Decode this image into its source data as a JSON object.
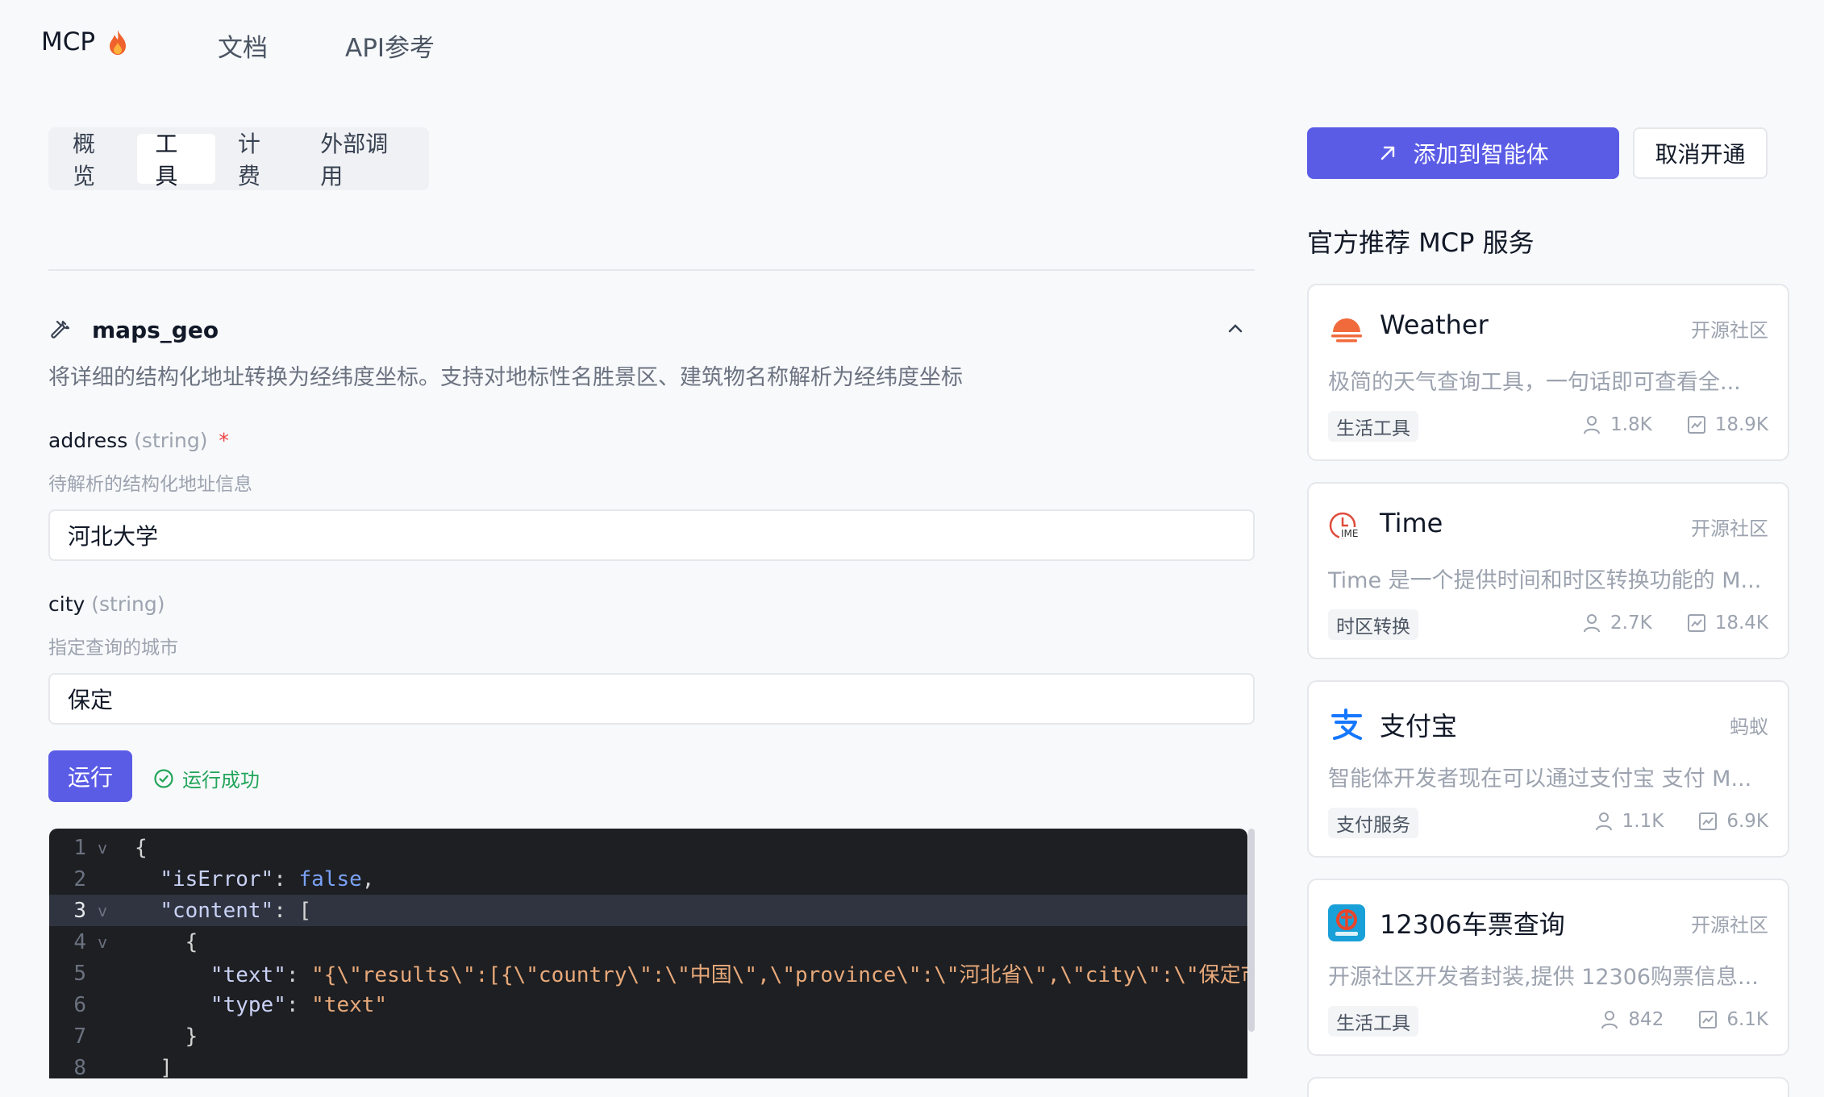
{
  "nav": {
    "brand": "MCP",
    "brand_icon": "flame-icon",
    "links": [
      "文档",
      "API参考"
    ]
  },
  "tabs": [
    {
      "label": "概览",
      "active": false
    },
    {
      "label": "工具",
      "active": true
    },
    {
      "label": "计费",
      "active": false
    },
    {
      "label": "外部调用",
      "active": false
    }
  ],
  "tool": {
    "name": "maps_geo",
    "description": "将详细的结构化地址转换为经纬度坐标。支持对地标性名胜景区、建筑物名称解析为经纬度坐标",
    "fields": [
      {
        "name": "address",
        "type": "(string)",
        "required": "*",
        "help": "待解析的结构化地址信息",
        "value": "河北大学"
      },
      {
        "name": "city",
        "type": "(string)",
        "required": "",
        "help": "指定查询的城市",
        "value": "保定"
      }
    ],
    "run_label": "运行",
    "run_status": "运行成功"
  },
  "code": {
    "lines": [
      {
        "n": "1",
        "fold": "v",
        "text": "{"
      },
      {
        "n": "2",
        "fold": "",
        "text": "  \"isError\": false,"
      },
      {
        "n": "3",
        "fold": "v",
        "text": "  \"content\": ["
      },
      {
        "n": "4",
        "fold": "v",
        "text": "    {"
      },
      {
        "n": "5",
        "fold": "",
        "text": "      \"text\": \"{\\\"results\\\":[{\\\"country\\\":\\\"中国\\\",\\\"province\\\":\\\"河北省\\\",\\\"city\\\":\\\"保定市"
      },
      {
        "n": "6",
        "fold": "",
        "text": "      \"type\": \"text\""
      },
      {
        "n": "7",
        "fold": "",
        "text": "    }"
      },
      {
        "n": "8",
        "fold": "",
        "text": "  ]"
      }
    ],
    "current_line": 3
  },
  "actions": {
    "add_label": "添加到智能体",
    "cancel_label": "取消开通"
  },
  "recommend": {
    "title": "官方推荐 MCP 服务",
    "cards": [
      {
        "name": "Weather",
        "source": "开源社区",
        "desc": "极简的天气查询工具，一句话即可查看全...",
        "tag": "生活工具",
        "users": "1.8K",
        "calls": "18.9K",
        "icon": "weather-sun-icon"
      },
      {
        "name": "Time",
        "source": "开源社区",
        "desc": "Time 是一个提供时间和时区转换功能的 M...",
        "tag": "时区转换",
        "users": "2.7K",
        "calls": "18.4K",
        "icon": "clock-icon"
      },
      {
        "name": "支付宝",
        "source": "蚂蚁",
        "desc": "智能体开发者现在可以通过支付宝 支付 M...",
        "tag": "支付服务",
        "users": "1.1K",
        "calls": "6.9K",
        "icon": "alipay-icon"
      },
      {
        "name": "12306车票查询",
        "source": "开源社区",
        "desc": "开源社区开发者封装,提供 12306购票信息...",
        "tag": "生活工具",
        "users": "842",
        "calls": "6.1K",
        "icon": "railway-icon"
      }
    ]
  },
  "colors": {
    "accent": "#5b5ce6",
    "success": "#22a55a",
    "code_bg": "#1e1f22"
  }
}
